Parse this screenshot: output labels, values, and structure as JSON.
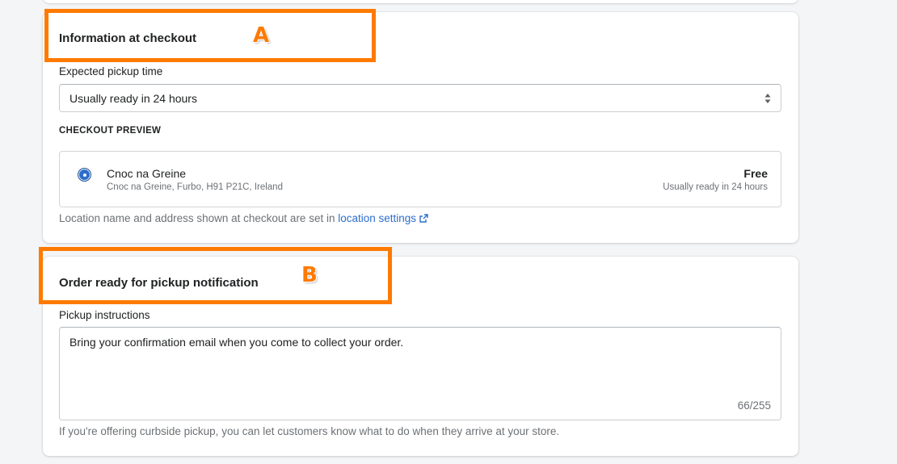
{
  "section_a": {
    "title": "Information at checkout",
    "pickup_time_label": "Expected pickup time",
    "pickup_time_value": "Usually ready in 24 hours",
    "preview_heading": "CHECKOUT PREVIEW",
    "preview": {
      "location_name": "Cnoc na Greine",
      "location_address": "Cnoc na Greine, Furbo, H91 P21C, Ireland",
      "price": "Free",
      "ready_text": "Usually ready in 24 hours"
    },
    "help_text_prefix": "Location name and address shown at checkout are set in ",
    "help_link": "location settings"
  },
  "section_b": {
    "title": "Order ready for pickup notification",
    "instructions_label": "Pickup instructions",
    "instructions_value": "Bring your confirmation email when you come to collect your order.",
    "char_count": "66/255",
    "help_text": "If you're offering curbside pickup, you can let customers know what to do when they arrive at your store."
  },
  "annotations": {
    "a": "A",
    "b": "B"
  },
  "colors": {
    "accent": "#2c6ecb",
    "annotation": "#ff7a00"
  },
  "icons": {
    "select_arrows": "select-arrows-icon",
    "external_link": "external-link-icon"
  }
}
